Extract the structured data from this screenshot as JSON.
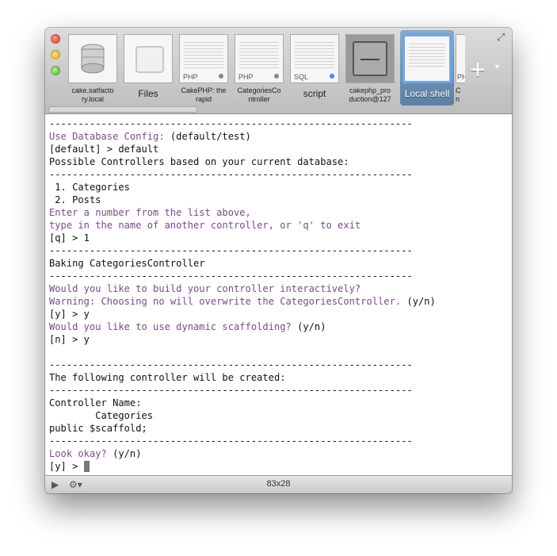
{
  "tabs": [
    {
      "label": "cake.satfactory.local",
      "label_lines": [
        "cake.satfacto",
        "ry.local"
      ],
      "icon": "cakephp-logo-icon",
      "tag": ""
    },
    {
      "label": "Files",
      "label_lines": [
        "Files"
      ],
      "icon": "files-icon",
      "tag": ""
    },
    {
      "label": "CakePHP: the rapid",
      "label_lines": [
        "CakePHP: the",
        "rapid"
      ],
      "icon": "document-icon",
      "tag": "PHP"
    },
    {
      "label": "CategoriesController",
      "label_lines": [
        "CategoriesCo",
        "ntroller"
      ],
      "icon": "document-icon",
      "tag": "PHP"
    },
    {
      "label": "script",
      "label_lines": [
        "script"
      ],
      "icon": "document-icon",
      "tag": "SQL"
    },
    {
      "label": "cakephp_production@127",
      "label_lines": [
        "cakephp_pro",
        "duction@127"
      ],
      "icon": "server-icon",
      "tag": ""
    },
    {
      "label": "Local shell",
      "label_lines": [
        "Local shell"
      ],
      "icon": "terminal-icon",
      "tag": ""
    },
    {
      "label": "C",
      "label_lines": [
        "C",
        "n"
      ],
      "icon": "document-icon",
      "tag": "PH"
    }
  ],
  "terminal": {
    "lines": [
      [
        {
          "t": "---------------------------------------------------------------",
          "c": "n"
        }
      ],
      [
        {
          "t": "Use Database Config: ",
          "c": "p"
        },
        {
          "t": "(default/test)",
          "c": "n"
        }
      ],
      [
        {
          "t": "[default] > default",
          "c": "n"
        }
      ],
      [
        {
          "t": "Possible Controllers based on your current database:",
          "c": "n"
        }
      ],
      [
        {
          "t": "---------------------------------------------------------------",
          "c": "n"
        }
      ],
      [
        {
          "t": " 1. Categories",
          "c": "n"
        }
      ],
      [
        {
          "t": " 2. Posts",
          "c": "n"
        }
      ],
      [
        {
          "t": "Enter a number from the list above,",
          "c": "p"
        }
      ],
      [
        {
          "t": "type in the name of another controller, or 'q' to exit",
          "c": "p"
        }
      ],
      [
        {
          "t": "[q] > 1",
          "c": "n"
        }
      ],
      [
        {
          "t": "---------------------------------------------------------------",
          "c": "n"
        }
      ],
      [
        {
          "t": "Baking CategoriesController",
          "c": "n"
        }
      ],
      [
        {
          "t": "---------------------------------------------------------------",
          "c": "n"
        }
      ],
      [
        {
          "t": "Would you like to build your controller interactively?",
          "c": "p"
        }
      ],
      [
        {
          "t": "Warning: Choosing no will overwrite the CategoriesController. ",
          "c": "p"
        },
        {
          "t": "(y/n)",
          "c": "n"
        }
      ],
      [
        {
          "t": "[y] > y",
          "c": "n"
        }
      ],
      [
        {
          "t": "Would you like to use dynamic scaffolding? ",
          "c": "p"
        },
        {
          "t": "(y/n)",
          "c": "n"
        }
      ],
      [
        {
          "t": "[n] > y",
          "c": "n"
        }
      ],
      [
        {
          "t": "",
          "c": "n"
        }
      ],
      [
        {
          "t": "---------------------------------------------------------------",
          "c": "n"
        }
      ],
      [
        {
          "t": "The following controller will be created:",
          "c": "n"
        }
      ],
      [
        {
          "t": "---------------------------------------------------------------",
          "c": "n"
        }
      ],
      [
        {
          "t": "Controller Name:",
          "c": "n"
        }
      ],
      [
        {
          "t": "        Categories",
          "c": "n"
        }
      ],
      [
        {
          "t": "public $scaffold;",
          "c": "n"
        }
      ],
      [
        {
          "t": "---------------------------------------------------------------",
          "c": "n"
        }
      ],
      [
        {
          "t": "Look okay? ",
          "c": "p"
        },
        {
          "t": "(y/n)",
          "c": "n"
        }
      ],
      [
        {
          "t": "[y] > ",
          "c": "n"
        }
      ]
    ]
  },
  "statusbar": {
    "size": "83x28",
    "play_icon": "play-icon",
    "settings_icon": "gear-icon"
  },
  "toolbar": {
    "add_icon": "plus-icon",
    "fullscreen_icon": "resize-icon"
  },
  "colors": {
    "prompt": "#7a4a8a",
    "text": "#111111",
    "active_tab": "#6ea8e6"
  }
}
